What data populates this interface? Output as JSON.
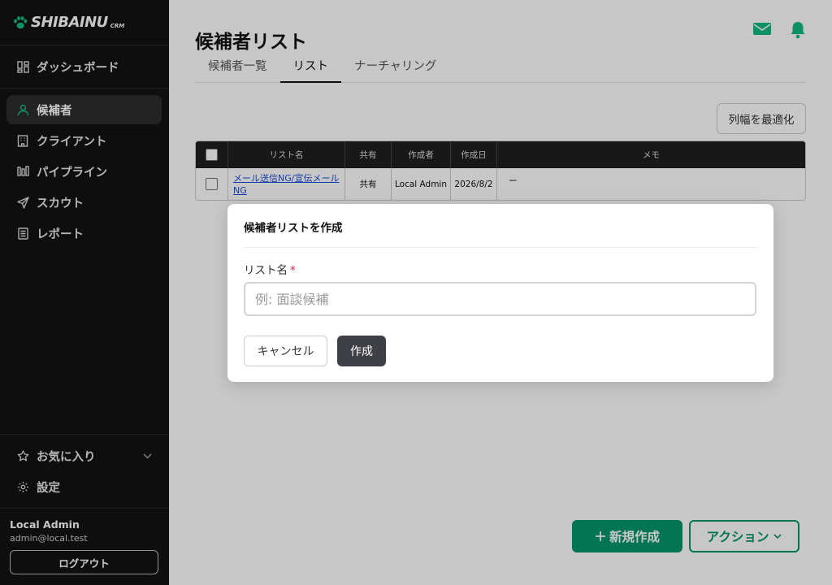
{
  "app": {
    "logo_text": "SHIBAINU",
    "logo_sub": "CRM",
    "accent_color": "#10b981"
  },
  "sidebar": {
    "dashboard": {
      "label": "ダッシュボード",
      "icon": "dashboard-icon"
    },
    "items": [
      {
        "label": "候補者",
        "icon": "user-icon",
        "active": true
      },
      {
        "label": "クライアント",
        "icon": "building-icon"
      },
      {
        "label": "パイプライン",
        "icon": "pipeline-icon"
      },
      {
        "label": "スカウト",
        "icon": "send-icon"
      },
      {
        "label": "レポート",
        "icon": "report-icon"
      }
    ],
    "favorites_label": "お気に入り",
    "settings_label": "設定",
    "user": {
      "name": "Local Admin",
      "email": "admin@local.test",
      "logout_label": "ログアウト"
    }
  },
  "main": {
    "title": "候補者リスト",
    "tabs": [
      {
        "label": "候補者一覧"
      },
      {
        "label": "リスト",
        "active": true
      },
      {
        "label": "ナーチャリング"
      }
    ],
    "optimize_label": "列幅を最適化",
    "table": {
      "headers": [
        "リスト名",
        "共有",
        "作成者",
        "作成日",
        "メモ"
      ],
      "rows": [
        {
          "name": "メール送信NG/宣伝メールNG",
          "shared": "共有",
          "owner": "Local Admin",
          "date": "2026/8/2",
          "memo": "ー"
        }
      ]
    },
    "new_label": "新規作成",
    "action_label": "アクション"
  },
  "modal": {
    "title": "候補者リストを作成",
    "field_label": "リスト名",
    "required_mark": "*",
    "placeholder": "例: 面談候補",
    "value": "",
    "cancel_label": "キャンセル",
    "create_label": "作成"
  }
}
